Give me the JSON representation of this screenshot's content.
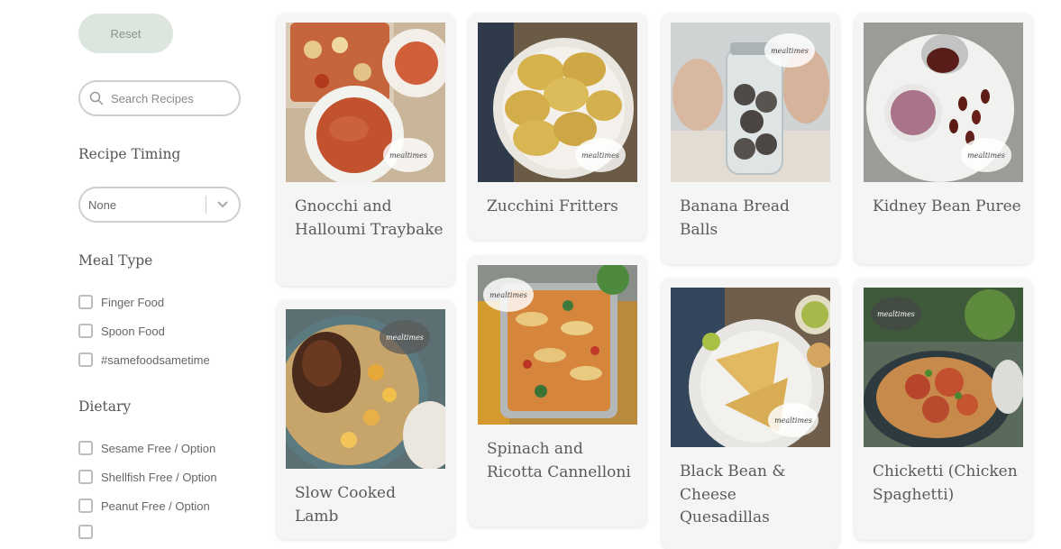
{
  "filters": {
    "reset_label": "Reset",
    "search": {
      "placeholder": "Search Recipes",
      "value": ""
    },
    "timing": {
      "title": "Recipe Timing",
      "selected": "None"
    },
    "meal_type": {
      "title": "Meal Type",
      "options": [
        "Finger Food",
        "Spoon Food",
        "#samefoodsametime"
      ]
    },
    "dietary": {
      "title": "Dietary",
      "options": [
        "Sesame Free / Option",
        "Shellfish Free / Option",
        "Peanut Free / Option"
      ]
    }
  },
  "recipes": [
    {
      "title": "Gnocchi and Halloumi Traybake",
      "image": "gnocchi-traybake-photo"
    },
    {
      "title": "Zucchini Fritters",
      "image": "zucchini-fritters-photo"
    },
    {
      "title": "Banana Bread Balls",
      "image": "banana-bread-balls-photo"
    },
    {
      "title": "Kidney Bean Puree",
      "image": "kidney-bean-puree-photo"
    },
    {
      "title": "Slow Cooked Lamb",
      "image": "slow-cooked-lamb-photo"
    },
    {
      "title": "Spinach and Ricotta Cannelloni",
      "image": "cannelloni-photo"
    },
    {
      "title": "Black Bean & Cheese Quesadillas",
      "image": "quesadillas-photo"
    },
    {
      "title": "Chicketti (Chicken Spaghetti)",
      "image": "chicketti-photo"
    }
  ],
  "colors": {
    "reset_bg": "#dde5df",
    "card_bg": "#f5f5f5",
    "border": "#cfcfcf"
  }
}
